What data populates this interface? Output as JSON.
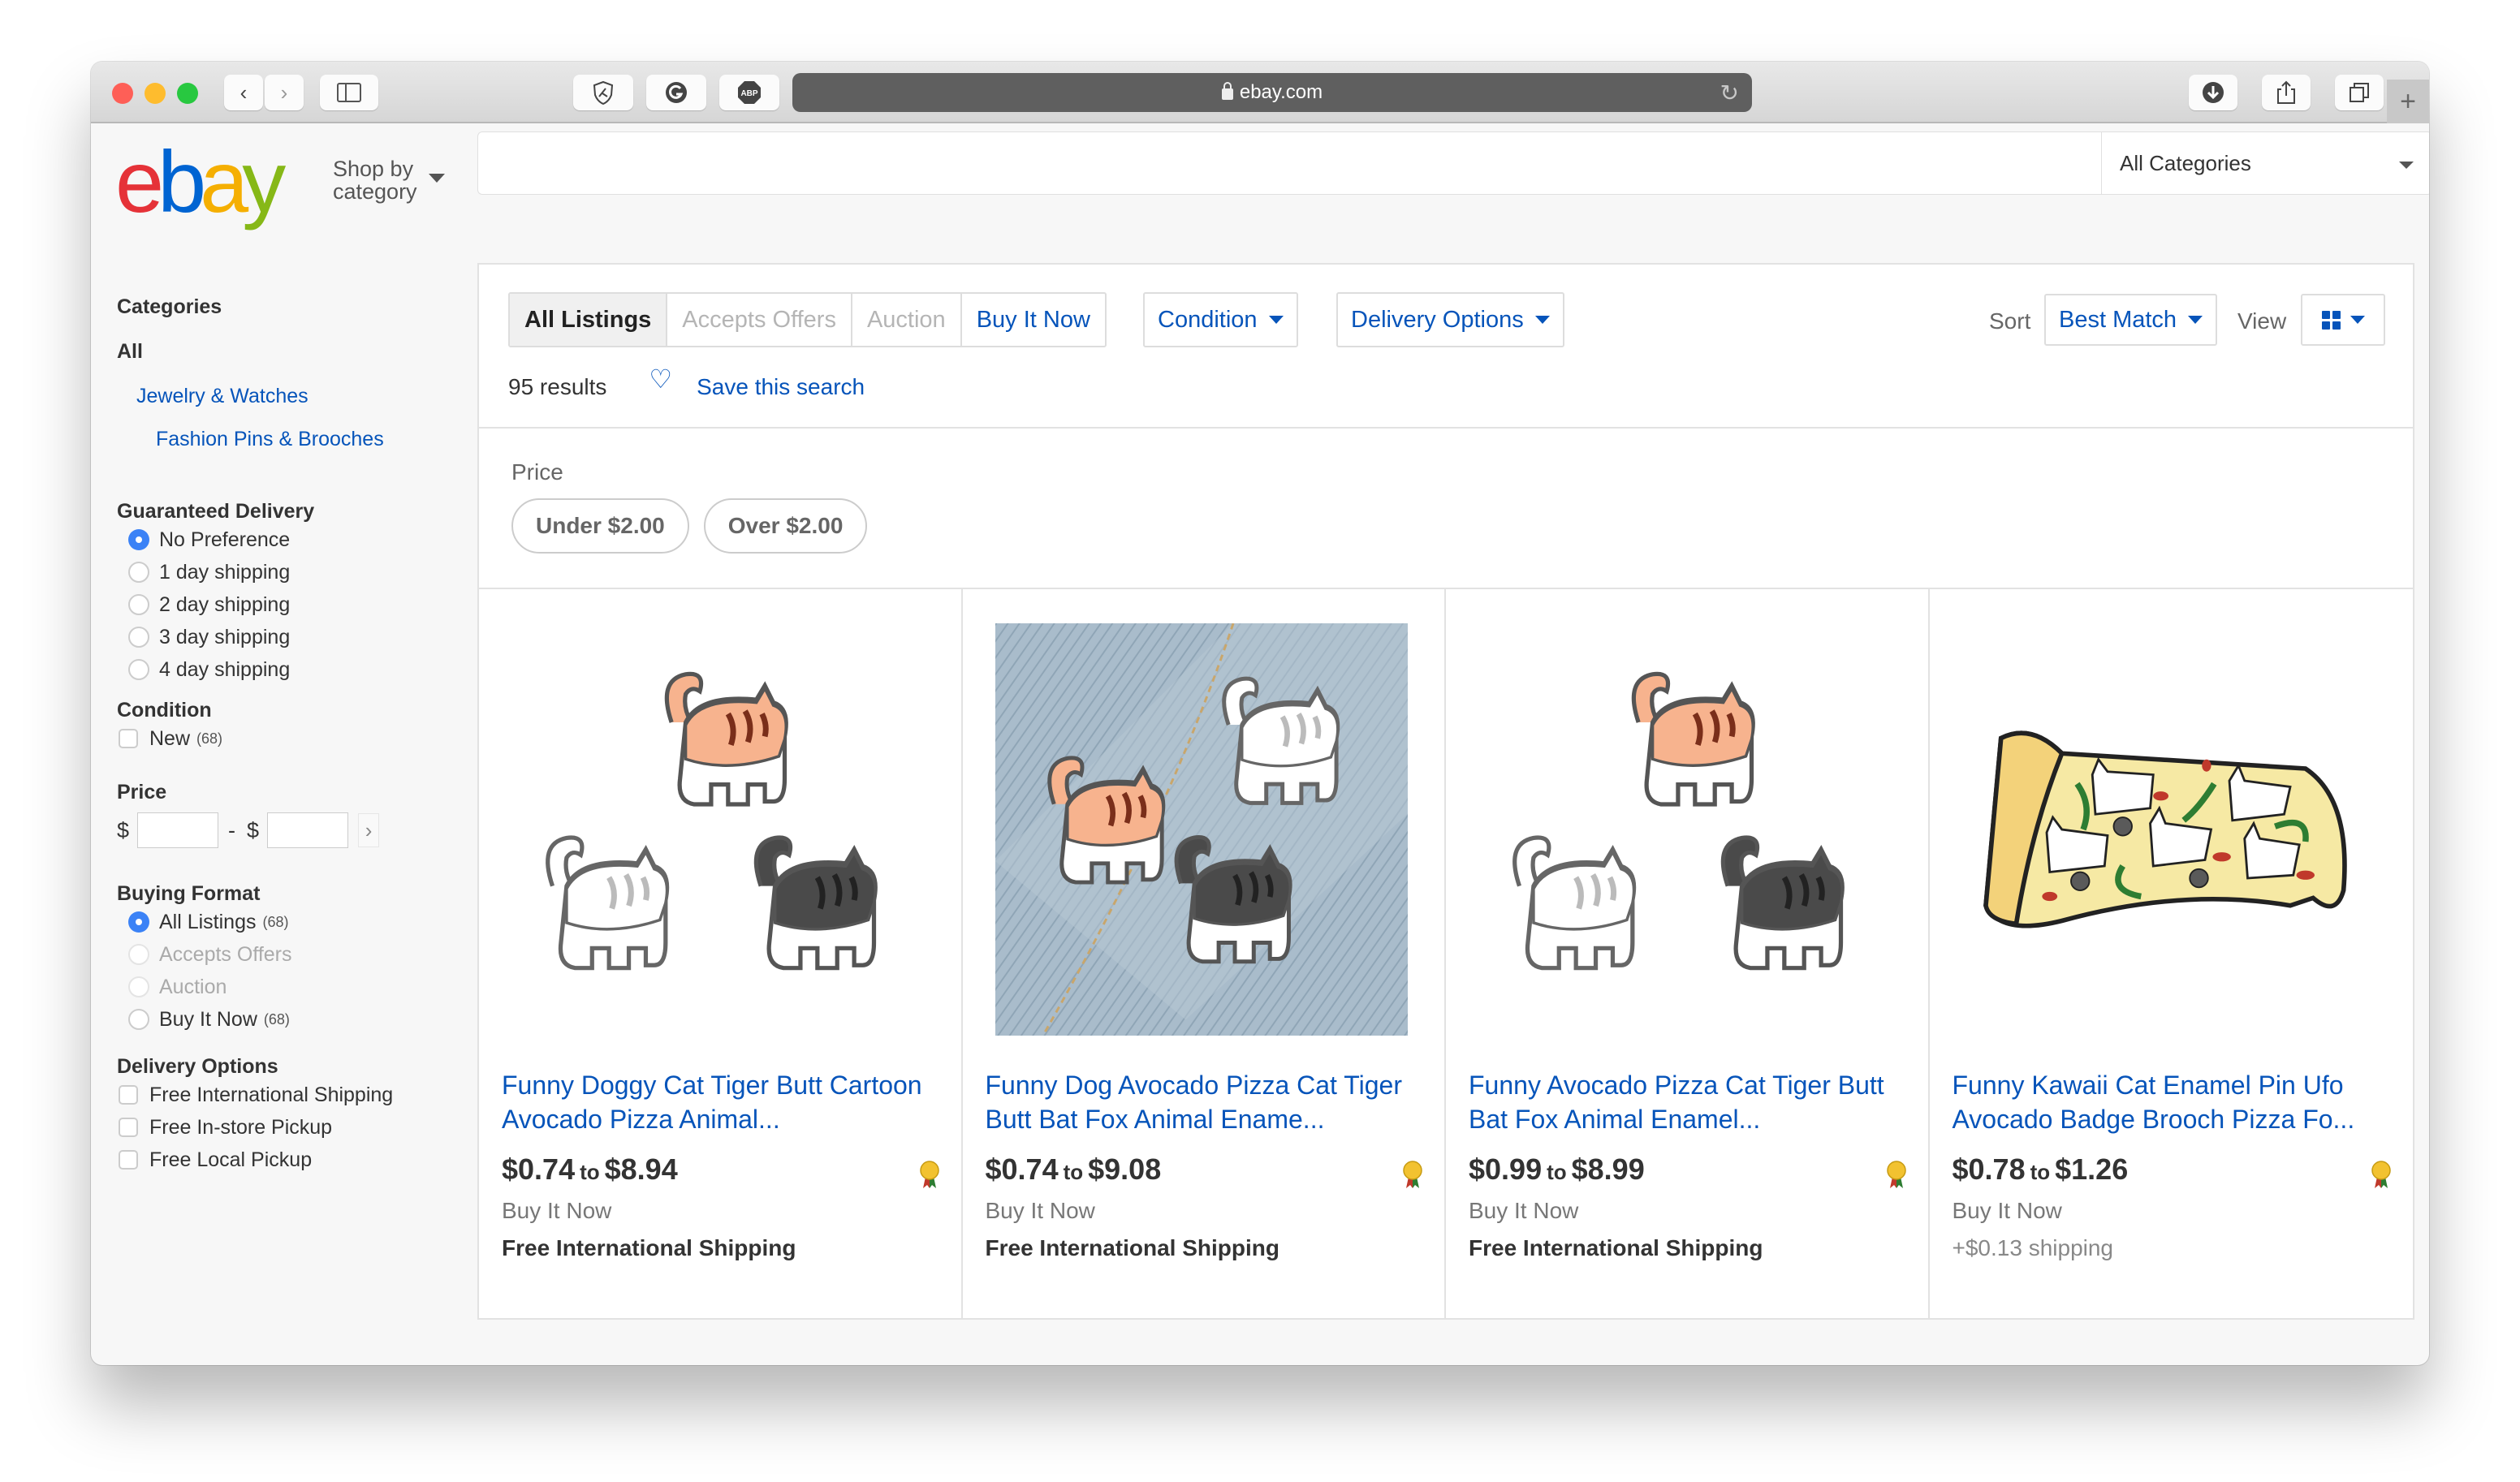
{
  "browser": {
    "url": "ebay.com",
    "toolbar_icons": [
      "back-icon",
      "forward-icon",
      "sidebar-icon",
      "shield-extension-icon",
      "grammarly-icon",
      "adblock-plus-icon",
      "reload-icon",
      "download-icon",
      "share-icon",
      "tabs-icon",
      "new-tab-icon"
    ],
    "abp_label": "ABP",
    "new_tab": "+"
  },
  "header": {
    "logo": {
      "e": "e",
      "b": "b",
      "a": "a",
      "y": "y"
    },
    "shop_by_line1": "Shop by",
    "shop_by_line2": "category",
    "search_value": "",
    "category_select": "All Categories"
  },
  "sidebar": {
    "categories_heading": "Categories",
    "categories_all": "All",
    "category_l1": "Jewelry & Watches",
    "category_l2": "Fashion Pins & Brooches",
    "guaranteed_delivery": {
      "heading": "Guaranteed Delivery",
      "options": [
        {
          "label": "No Preference",
          "selected": true
        },
        {
          "label": "1 day shipping",
          "selected": false
        },
        {
          "label": "2 day shipping",
          "selected": false
        },
        {
          "label": "3 day shipping",
          "selected": false
        },
        {
          "label": "4 day shipping",
          "selected": false
        }
      ]
    },
    "condition": {
      "heading": "Condition",
      "options": [
        {
          "label": "New",
          "count": "(68)",
          "checked": false
        }
      ]
    },
    "price": {
      "heading": "Price",
      "currency": "$",
      "separator": "-",
      "min": "",
      "max": "",
      "go": "›"
    },
    "buying_format": {
      "heading": "Buying Format",
      "options": [
        {
          "label": "All Listings",
          "count": "(68)",
          "selected": true,
          "disabled": false
        },
        {
          "label": "Accepts Offers",
          "count": "",
          "selected": false,
          "disabled": true
        },
        {
          "label": "Auction",
          "count": "",
          "selected": false,
          "disabled": true
        },
        {
          "label": "Buy It Now",
          "count": "(68)",
          "selected": false,
          "disabled": false
        }
      ]
    },
    "delivery_options": {
      "heading": "Delivery Options",
      "options": [
        {
          "label": "Free International Shipping",
          "checked": false
        },
        {
          "label": "Free In-store Pickup",
          "checked": false
        },
        {
          "label": "Free Local Pickup",
          "checked": false
        }
      ]
    }
  },
  "main": {
    "format_tabs": [
      {
        "label": "All Listings",
        "state": "active"
      },
      {
        "label": "Accepts Offers",
        "state": "disabled"
      },
      {
        "label": "Auction",
        "state": "disabled"
      },
      {
        "label": "Buy It Now",
        "state": "link"
      }
    ],
    "condition_dropdown": "Condition",
    "delivery_dropdown": "Delivery Options",
    "results_count": "95 results",
    "save_search": "Save this search",
    "sort_label": "Sort",
    "sort_value": "Best Match",
    "view_label": "View",
    "view_value": "grid-icon",
    "price_filter_label": "Price",
    "price_chips": [
      "Under $2.00",
      "Over $2.00"
    ]
  },
  "listings": [
    {
      "title": "Funny Doggy Cat Tiger Butt Cartoon Avocado Pizza Animal...",
      "price_low": "$0.74",
      "to": "to",
      "price_high": "$8.94",
      "format": "Buy It Now",
      "shipping": "Free International Shipping",
      "shipping_free": true,
      "image": "three-cat-butt-pins",
      "badge": "top-rated-seller-icon"
    },
    {
      "title": "Funny Dog Avocado Pizza Cat Tiger Butt Bat Fox Animal Ename...",
      "price_low": "$0.74",
      "to": "to",
      "price_high": "$9.08",
      "format": "Buy It Now",
      "shipping": "Free International Shipping",
      "shipping_free": true,
      "image": "cat-pins-on-denim",
      "badge": "top-rated-seller-icon"
    },
    {
      "title": "Funny Avocado Pizza Cat Tiger Butt Bat Fox Animal Enamel...",
      "price_low": "$0.99",
      "to": "to",
      "price_high": "$8.99",
      "format": "Buy It Now",
      "shipping": "Free International Shipping",
      "shipping_free": true,
      "image": "three-cat-butt-pins",
      "badge": "top-rated-seller-icon"
    },
    {
      "title": "Funny Kawaii Cat Enamel Pin Ufo Avocado Badge Brooch Pizza Fo...",
      "price_low": "$0.78",
      "to": "to",
      "price_high": "$1.26",
      "format": "Buy It Now",
      "shipping": "+$0.13 shipping",
      "shipping_free": false,
      "image": "pizza-slice-cats-pin",
      "badge": "top-rated-seller-icon"
    }
  ],
  "colors": {
    "ebay_red": "#e53238",
    "ebay_blue": "#0064d2",
    "ebay_yellow": "#f5af02",
    "ebay_green": "#86b817",
    "link_blue": "#0654ba",
    "radio_selected": "#3b82f6"
  }
}
